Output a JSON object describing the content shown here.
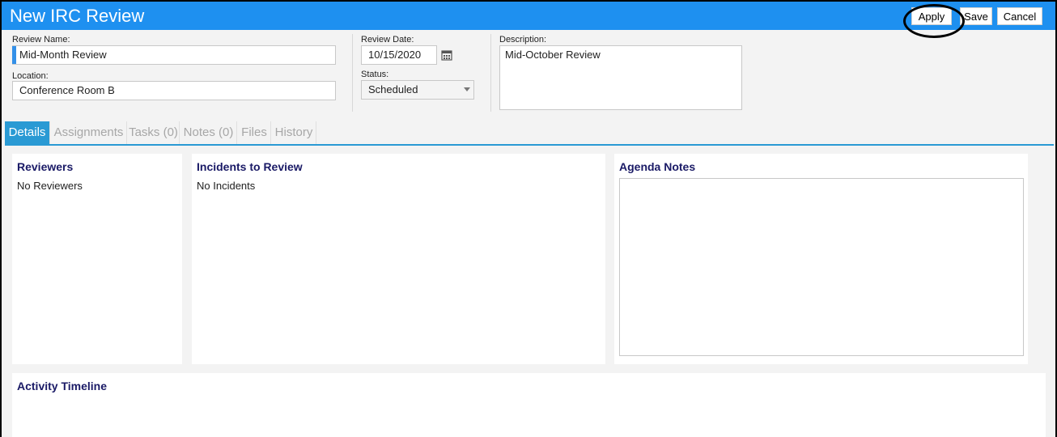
{
  "window": {
    "title": "New IRC Review",
    "buttons": {
      "apply": "Apply",
      "save": "Save",
      "cancel": "Cancel"
    }
  },
  "form": {
    "review_name": {
      "label": "Review Name:",
      "value": "Mid-Month Review"
    },
    "location": {
      "label": "Location:",
      "value": "Conference Room B"
    },
    "review_date": {
      "label": "Review Date:",
      "value": "10/15/2020"
    },
    "status": {
      "label": "Status:",
      "value": "Scheduled"
    },
    "description": {
      "label": "Description:",
      "value": "Mid-October Review"
    }
  },
  "tabs": [
    "Details",
    "Assignments",
    "Tasks (0)",
    "Notes (0)",
    "Files",
    "History"
  ],
  "panels": {
    "reviewers": {
      "title": "Reviewers",
      "empty": "No Reviewers"
    },
    "incidents": {
      "title": "Incidents to Review",
      "empty": "No Incidents"
    },
    "agenda": {
      "title": "Agenda Notes"
    },
    "timeline": {
      "title": "Activity Timeline"
    }
  },
  "colors": {
    "titlebar": "#1e90f0",
    "accent": "#3390e8",
    "tab_active": "#2a9ad4",
    "panel_title": "#1a1a66"
  },
  "icons": {
    "date_picker": "calendar-icon",
    "status_dropdown": "chevron-down-icon"
  }
}
